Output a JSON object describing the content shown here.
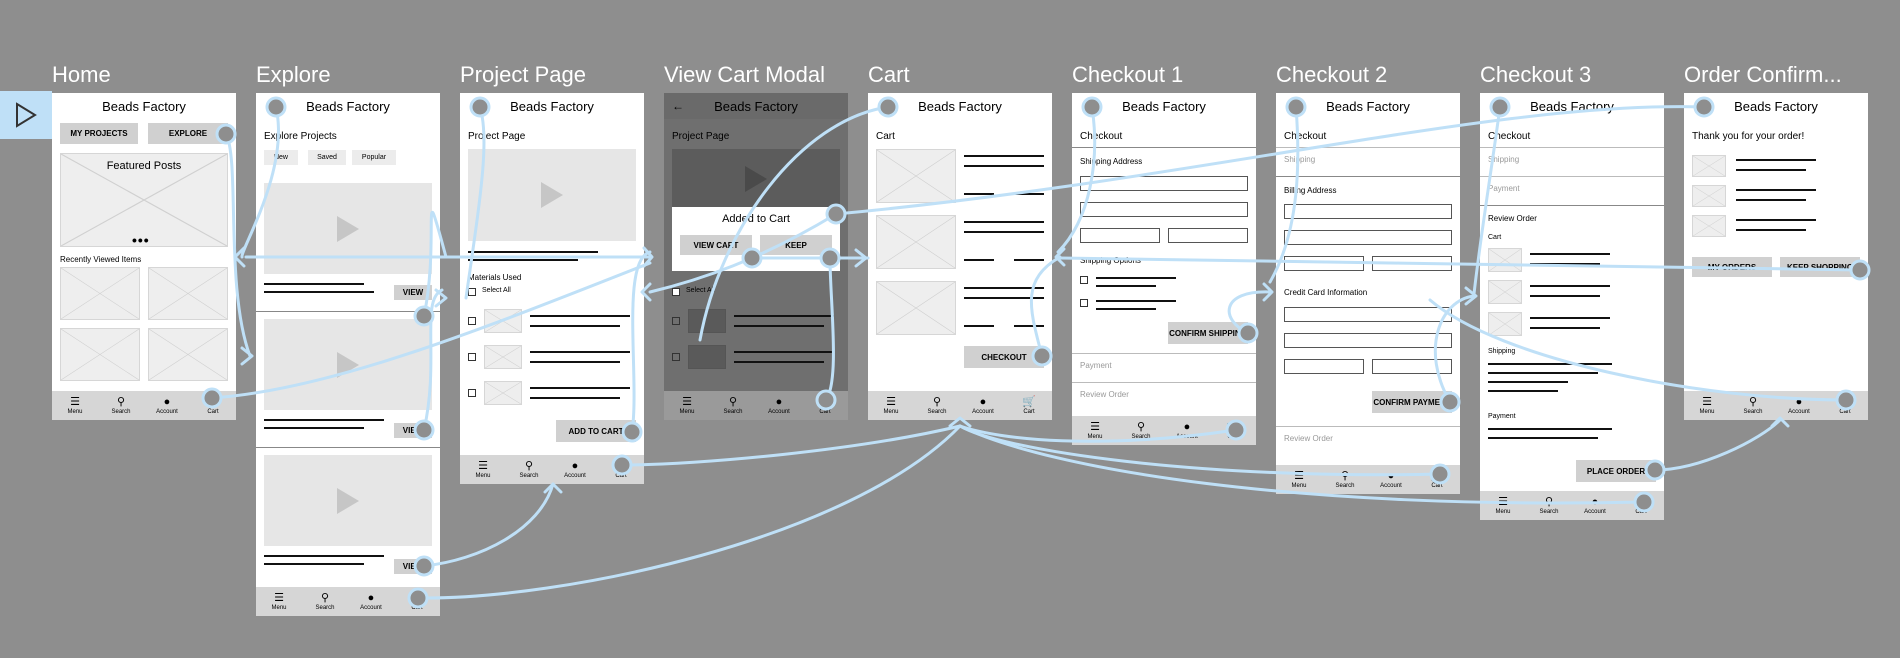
{
  "app_name": "Beads Factory",
  "screens": {
    "home": {
      "title": "Home",
      "my_projects": "MY PROJECTS",
      "explore": "EXPLORE",
      "featured": "Featured Posts",
      "recent": "Recently Viewed Items",
      "dots": "•••"
    },
    "explore": {
      "title": "Explore",
      "heading": "Explore Projects",
      "tabs": [
        "New",
        "Saved",
        "Popular"
      ],
      "view": "VIEW"
    },
    "project": {
      "title": "Project Page",
      "heading": "Project Page",
      "materials": "Materials Used",
      "select_all": "Select All",
      "add_to_cart": "ADD TO CART"
    },
    "modal": {
      "title": "View Cart Modal",
      "heading": "Project Page",
      "added": "Added to Cart",
      "view_cart": "VIEW CART",
      "keep": "KEEP",
      "select_all": "Select All"
    },
    "cart": {
      "title": "Cart",
      "heading": "Cart",
      "checkout": "CHECKOUT"
    },
    "checkout1": {
      "title": "Checkout 1",
      "heading": "Checkout",
      "shipping_address": "Shipping Address",
      "shipping_options": "Shipping Options",
      "confirm": "CONFIRM SHIPPING",
      "payment": "Payment",
      "review": "Review Order"
    },
    "checkout2": {
      "title": "Checkout 2",
      "heading": "Checkout",
      "shipping": "Shipping",
      "billing": "Billing Address",
      "credit": "Credit Card Information",
      "confirm": "CONFIRM PAYMENT",
      "review": "Review Order"
    },
    "checkout3": {
      "title": "Checkout 3",
      "heading": "Checkout",
      "shipping": "Shipping",
      "payment": "Payment",
      "review": "Review Order",
      "cart": "Cart",
      "shipping2": "Shipping",
      "payment2": "Payment",
      "place": "PLACE ORDER"
    },
    "confirm": {
      "title": "Order Confirm...",
      "thanks": "Thank you for your order!",
      "my_orders": "MY ORDERS",
      "keep": "KEEP SHOPPING"
    }
  },
  "nav": {
    "menu": "Menu",
    "search": "Search",
    "account": "Account",
    "cart": "Cart",
    "menu_icon": "hamburger-icon",
    "search_icon": "search-icon",
    "account_icon": "account-icon",
    "cart_icon": "cart-icon"
  },
  "colors": {
    "canvas": "#8e8e8e",
    "wire": "#bfe0f7",
    "frame": "#ffffff",
    "button": "#d0d0d0"
  }
}
